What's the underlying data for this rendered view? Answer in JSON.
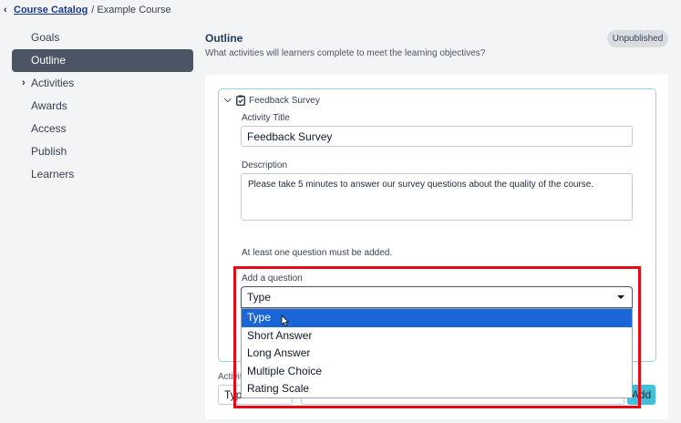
{
  "breadcrumb": {
    "back_link": "Course Catalog",
    "separator": "/",
    "current": "Example Course"
  },
  "sidebar": {
    "items": [
      {
        "label": "Goals"
      },
      {
        "label": "Outline",
        "active": true
      },
      {
        "label": "Activities",
        "has_chevron": true
      },
      {
        "label": "Awards"
      },
      {
        "label": "Access"
      },
      {
        "label": "Publish"
      },
      {
        "label": "Learners"
      }
    ]
  },
  "main": {
    "title": "Outline",
    "subtitle": "What activities will learners complete to meet the learning objectives?",
    "status": "Unpublished"
  },
  "activity_card": {
    "header": "Feedback Survey",
    "title_label": "Activity Title",
    "title_value": "Feedback Survey",
    "description_label": "Description",
    "description_value": "Please take 5 minutes to answer our survey questions about the quality of the course.",
    "note": "At least one question must be added.",
    "question_label": "Add a question",
    "question_select_value": "Type",
    "question_options": [
      "Type",
      "Short Answer",
      "Long Answer",
      "Multiple Choice",
      "Rating Scale"
    ],
    "selected_option_index": 0
  },
  "bottom_row": {
    "label": "Activit",
    "select_value": "Type",
    "add_button": "Add"
  },
  "colors": {
    "active_sidebar": "#4b5563",
    "card_border": "#8fd6df",
    "selected_option": "#1a66d6",
    "highlight": "#e50914",
    "add_button": "#41c0dc"
  }
}
